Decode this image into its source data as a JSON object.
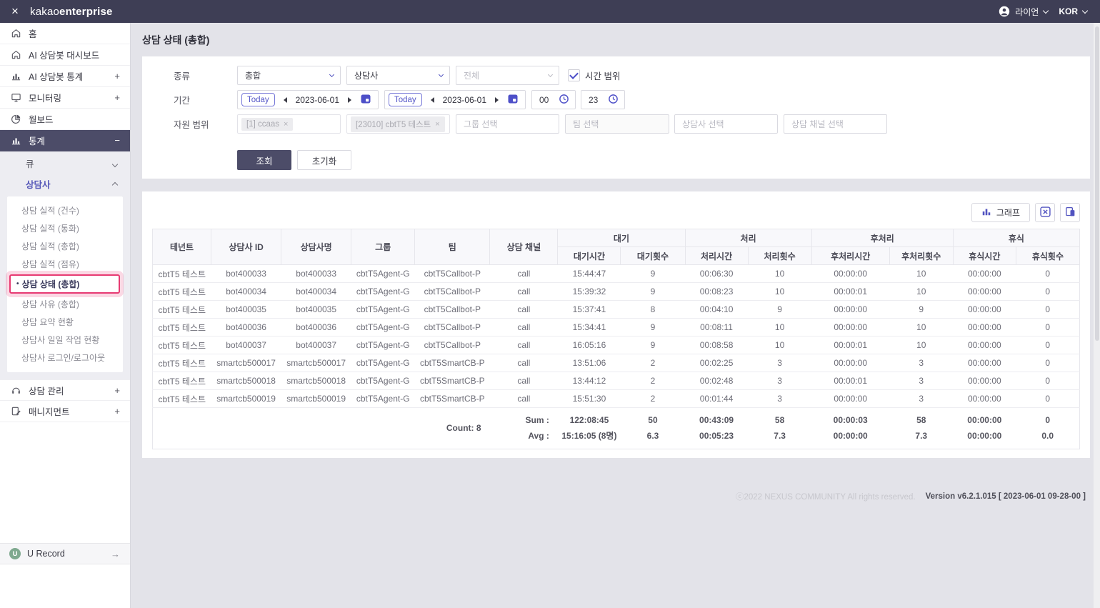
{
  "colors": {
    "topbar_bg": "#3e3e55",
    "accent_purple": "#5153c0",
    "active_menu_bg": "#4c4c68",
    "highlight_pink": "#e73a72",
    "primary_button_bg": "#4c4c68",
    "main_bg": "#e3e3e9",
    "table_header_bg": "#f8f8fb",
    "urecord_badge_green": "#7fa98f"
  },
  "icons": {
    "plus": "+",
    "minus": "−",
    "arrow_right": "→",
    "close": "×",
    "chip_close": "×",
    "bullet": "•"
  },
  "header": {
    "logo_regular": "kakao",
    "logo_bold": "enterprise",
    "user_name": "라이언",
    "language": "KOR"
  },
  "sidebar": {
    "items": [
      {
        "label": "홈"
      },
      {
        "label": "AI 상담봇 대시보드"
      },
      {
        "label": "AI 상담봇 통계",
        "expander": "+"
      },
      {
        "label": "모니터링",
        "expander": "+"
      },
      {
        "label": "월보드"
      },
      {
        "label": "통계",
        "expander": "−"
      }
    ],
    "submenu": {
      "group_collapsed": "큐",
      "group_expanded": "상담사",
      "links": [
        "상담 실적 (건수)",
        "상담 실적 (통화)",
        "상담 실적 (총합)",
        "상담 실적 (점유)",
        "상담 상태 (총합)",
        "상담 사유 (총합)",
        "상담 요약 현황",
        "상담사 일일 작업 현황",
        "상담사 로그인/로그아웃"
      ],
      "active_link": "상담 상태 (총합)"
    },
    "bottom_items": [
      {
        "label": "상담 관리",
        "expander": "+"
      },
      {
        "label": "매니지먼트",
        "expander": "+"
      }
    ],
    "footer_item": {
      "label": "U Record",
      "badge": "U"
    }
  },
  "page": {
    "title": "상담 상태 (총합)"
  },
  "filters": {
    "type_label": "종류",
    "type_select1": "총합",
    "type_select2": "상담사",
    "type_select3": "전체",
    "time_range_label": "시간 범위",
    "period_label": "기간",
    "today_label": "Today",
    "date_from": "2023-06-01",
    "date_to": "2023-06-01",
    "hour_from": "00",
    "hour_to": "23",
    "resource_label": "자원 범위",
    "tenant_tag1": "[1] ccaas",
    "tenant_tag2": "[23010] cbtT5 테스트",
    "group_placeholder": "그룹 선택",
    "team_placeholder": "팀 선택",
    "agent_placeholder": "상담사 선택",
    "channel_placeholder": "상담 채널 선택",
    "search_button": "조회",
    "reset_button": "초기화"
  },
  "toolbar": {
    "graph_button": "그래프"
  },
  "table": {
    "simple_headers": [
      "테넌트",
      "상담사 ID",
      "상담사명",
      "그룹",
      "팀",
      "상담 채널"
    ],
    "group_headers": [
      {
        "label": "대기",
        "children": [
          "대기시간",
          "대기횟수"
        ]
      },
      {
        "label": "처리",
        "children": [
          "처리시간",
          "처리횟수"
        ]
      },
      {
        "label": "후처리",
        "children": [
          "후처리시간",
          "후처리횟수"
        ]
      },
      {
        "label": "휴식",
        "children": [
          "휴식시간",
          "휴식횟수"
        ]
      }
    ],
    "rows": [
      [
        "cbtT5 테스트",
        "bot400033",
        "bot400033",
        "cbtT5Agent-G",
        "cbtT5Callbot-P",
        "call",
        "15:44:47",
        "9",
        "00:06:30",
        "10",
        "00:00:00",
        "10",
        "00:00:00",
        "0"
      ],
      [
        "cbtT5 테스트",
        "bot400034",
        "bot400034",
        "cbtT5Agent-G",
        "cbtT5Callbot-P",
        "call",
        "15:39:32",
        "9",
        "00:08:23",
        "10",
        "00:00:01",
        "10",
        "00:00:00",
        "0"
      ],
      [
        "cbtT5 테스트",
        "bot400035",
        "bot400035",
        "cbtT5Agent-G",
        "cbtT5Callbot-P",
        "call",
        "15:37:41",
        "8",
        "00:04:10",
        "9",
        "00:00:00",
        "9",
        "00:00:00",
        "0"
      ],
      [
        "cbtT5 테스트",
        "bot400036",
        "bot400036",
        "cbtT5Agent-G",
        "cbtT5Callbot-P",
        "call",
        "15:34:41",
        "9",
        "00:08:11",
        "10",
        "00:00:00",
        "10",
        "00:00:00",
        "0"
      ],
      [
        "cbtT5 테스트",
        "bot400037",
        "bot400037",
        "cbtT5Agent-G",
        "cbtT5Callbot-P",
        "call",
        "16:05:16",
        "9",
        "00:08:58",
        "10",
        "00:00:01",
        "10",
        "00:00:00",
        "0"
      ],
      [
        "cbtT5 테스트",
        "smartcb500017",
        "smartcb500017",
        "cbtT5Agent-G",
        "cbtT5SmartCB-P",
        "call",
        "13:51:06",
        "2",
        "00:02:25",
        "3",
        "00:00:00",
        "3",
        "00:00:00",
        "0"
      ],
      [
        "cbtT5 테스트",
        "smartcb500018",
        "smartcb500018",
        "cbtT5Agent-G",
        "cbtT5SmartCB-P",
        "call",
        "13:44:12",
        "2",
        "00:02:48",
        "3",
        "00:00:01",
        "3",
        "00:00:00",
        "0"
      ],
      [
        "cbtT5 테스트",
        "smartcb500019",
        "smartcb500019",
        "cbtT5Agent-G",
        "cbtT5SmartCB-P",
        "call",
        "15:51:30",
        "2",
        "00:01:44",
        "3",
        "00:00:00",
        "3",
        "00:00:00",
        "0"
      ]
    ],
    "summary": {
      "count_label": "Count: 8",
      "sum_label": "Sum :",
      "avg_label": "Avg :",
      "sum_values": [
        "122:08:45",
        "50",
        "00:43:09",
        "58",
        "00:00:03",
        "58",
        "00:00:00",
        "0"
      ],
      "avg_values": [
        "15:16:05 (8명)",
        "6.3",
        "00:05:23",
        "7.3",
        "00:00:00",
        "7.3",
        "00:00:00",
        "0.0"
      ]
    }
  },
  "footer": {
    "copyright": "ⓒ2022 NEXUS COMMUNITY All rights reserved.",
    "version": "Version v6.2.1.015 [ 2023-06-01 09-28-00 ]"
  }
}
